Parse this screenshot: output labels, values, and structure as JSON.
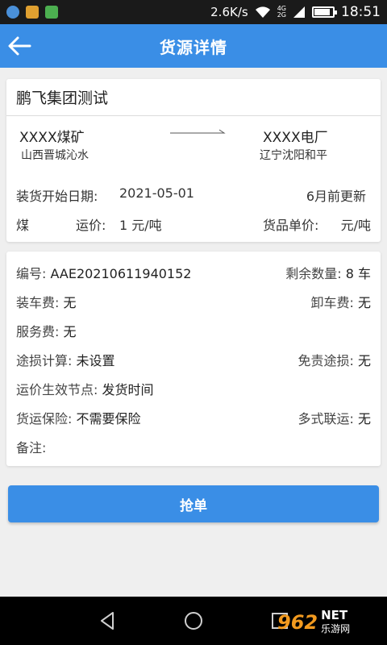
{
  "status_bar": {
    "net_speed": "2.6K/s",
    "signal_top": "4G",
    "signal_bottom": "2G",
    "time": "18:51"
  },
  "header": {
    "title": "货源详情",
    "back_icon": "arrow-left-icon"
  },
  "summary": {
    "company": "鹏飞集团测试",
    "origin_name": "XXXX煤矿",
    "origin_area": "山西晋城沁水",
    "dest_name": "XXXX电厂",
    "dest_area": "辽宁沈阳和平",
    "start_date_label": "装货开始日期:",
    "start_date": "2021-05-01",
    "updated": "6月前更新",
    "goods": "煤",
    "freight_label": "运价:",
    "freight": "1 元/吨",
    "unit_price_label": "货品单价:",
    "unit_price": "元/吨"
  },
  "details": {
    "serial_label": "编号:",
    "serial": "AAE20210611940152",
    "remaining_label": "剩余数量:",
    "remaining": "8 车",
    "loading_fee_label": "装车费:",
    "loading_fee": "无",
    "unloading_fee_label": "卸车费:",
    "unloading_fee": "无",
    "service_fee_label": "服务费:",
    "service_fee": "无",
    "loss_calc_label": "途损计算:",
    "loss_calc": "未设置",
    "exempt_loss_label": "免责途损:",
    "exempt_loss": "无",
    "effective_node_label": "运价生效节点:",
    "effective_node": "发货时间",
    "insurance_label": "货运保险:",
    "insurance": "不需要保险",
    "multimodal_label": "多式联运:",
    "multimodal": "无",
    "remark_label": "备注:",
    "remark": ""
  },
  "actions": {
    "grab_label": "抢单"
  },
  "watermark": {
    "number": "962",
    "net": "NET",
    "cn": "乐游网"
  },
  "colors": {
    "primary": "#3a8ee6",
    "background": "#efefef",
    "watermark_orange": "#f29a1f"
  }
}
